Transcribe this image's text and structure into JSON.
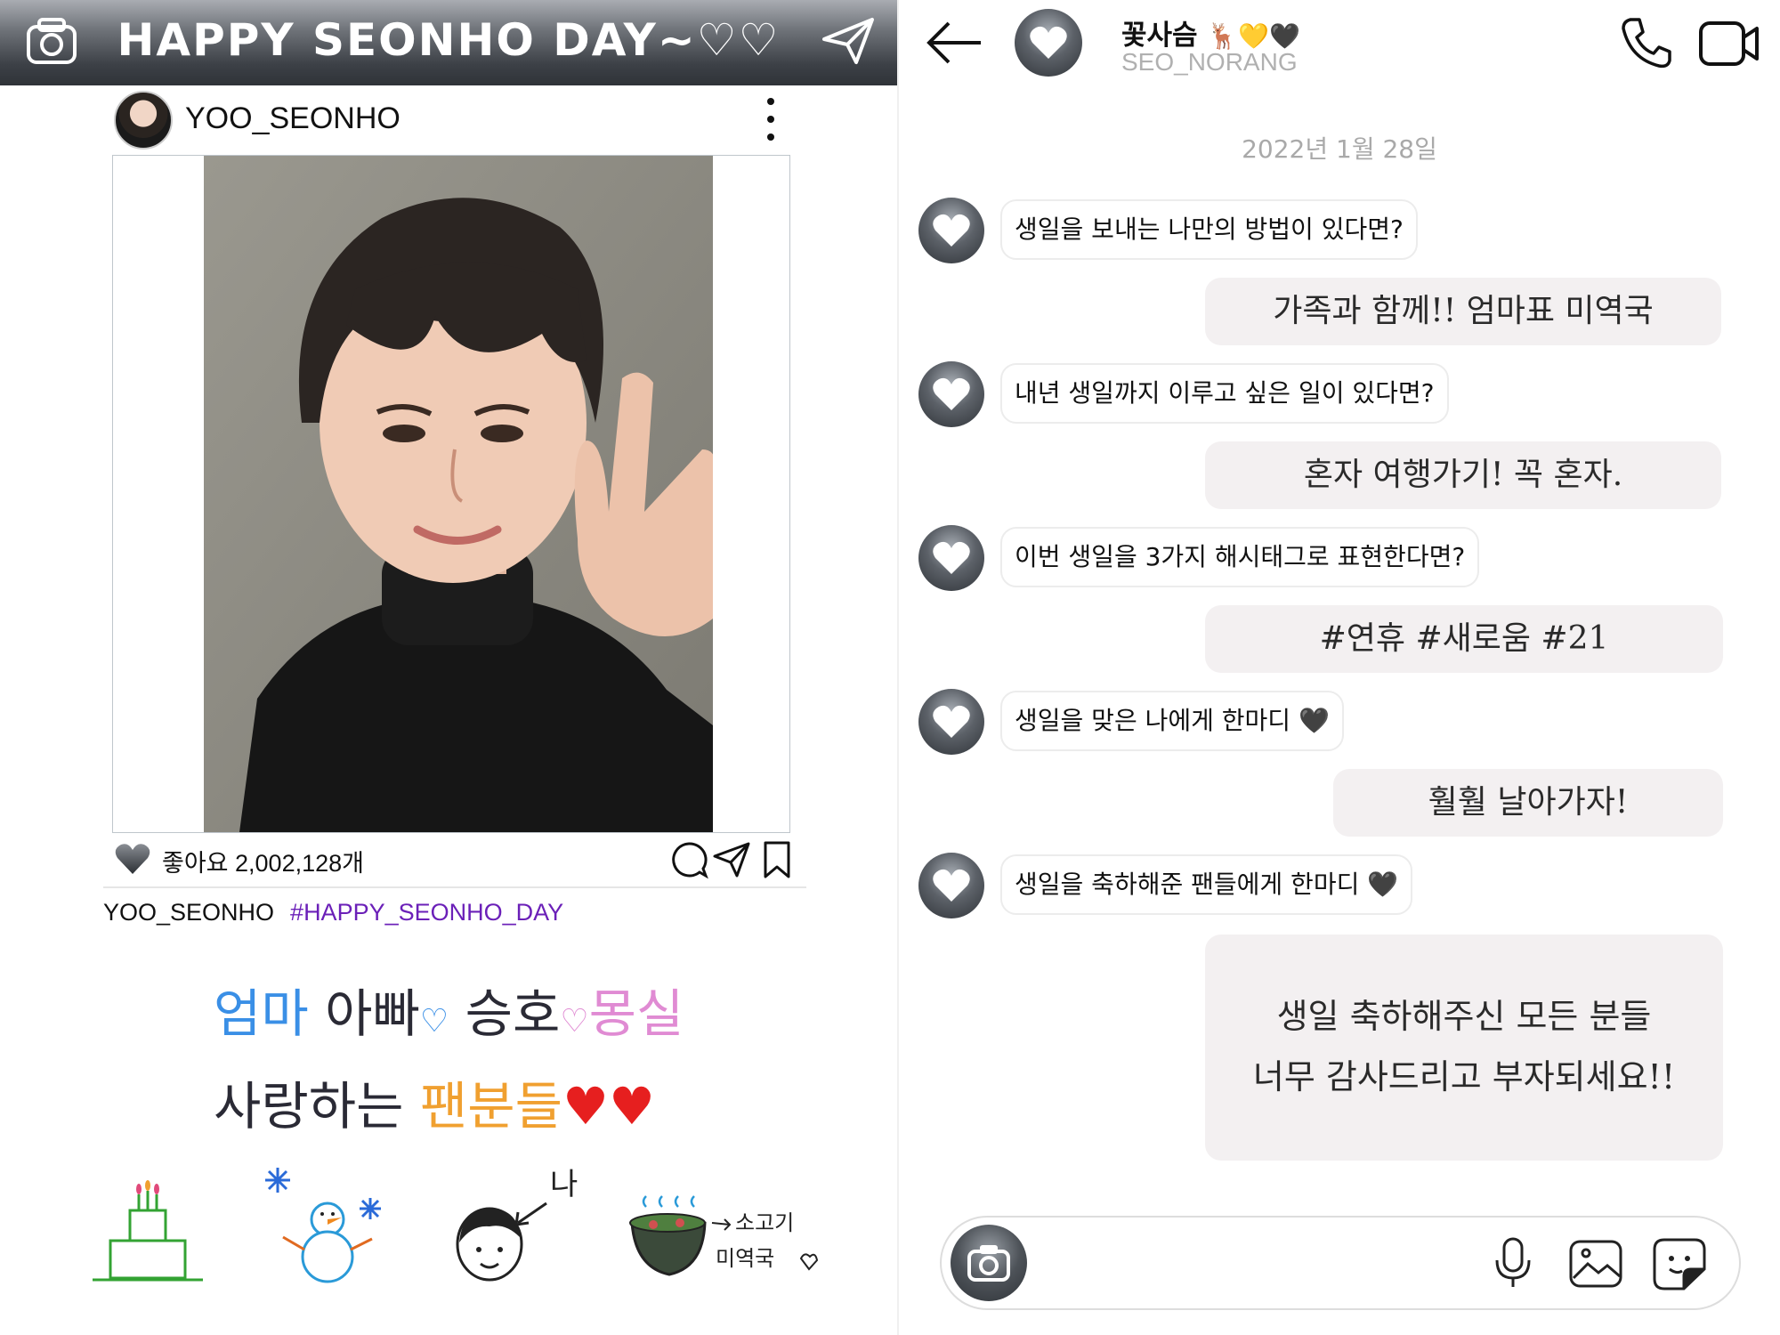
{
  "left": {
    "banner_title": "HAPPY SEONHO DAY~♡♡",
    "post": {
      "username": "YOO_SEONHO",
      "likes_text": "좋아요 2,002,128개",
      "caption_user": "YOO_SEONHO",
      "caption_tag": "#HAPPY_SEONHO_DAY"
    },
    "handwritten": {
      "line1": [
        "엄마",
        "아빠",
        "♡",
        "승호",
        "♡",
        "몽실"
      ],
      "line2": [
        "사랑하는",
        "팬분들",
        "♥♥"
      ]
    },
    "doodle_labels": {
      "me": "나",
      "soup1": "소고기",
      "soup2": "미역국"
    }
  },
  "right": {
    "chat_name": "꽃사슴",
    "chat_name_emoji": "🦌💛🖤",
    "chat_handle": "SEO_NORANG",
    "date": "2022년 1월 28일",
    "messages": [
      {
        "q": "생일을 보내는 나만의 방법이 있다면?",
        "a": "가족과 함께!! 엄마표 미역국"
      },
      {
        "q": "내년 생일까지 이루고 싶은 일이 있다면?",
        "a": "혼자 여행가기! 꼭 혼자."
      },
      {
        "q": "이번 생일을 3가지 해시태그로 표현한다면?",
        "a": "#연휴 #새로움 #21"
      },
      {
        "q": "생일을 맞은 나에게 한마디 🖤",
        "a": "훨훨 날아가자!"
      },
      {
        "q": "생일을 축하해준 팬들에게 한마디 🖤",
        "a1": "생일 축하해주신 모든 분들",
        "a2": "너무 감사드리고 부자되세요!!"
      }
    ]
  },
  "colors": {
    "banner": "#3d4147",
    "hashtag": "#6b20b8",
    "answer_bubble": "#f3f0f1",
    "date_text": "#a9a9a9"
  },
  "icons": [
    "camera-icon",
    "send-icon",
    "more-icon",
    "heart-icon",
    "comment-icon",
    "share-icon",
    "bookmark-icon",
    "back-arrow-icon",
    "phone-icon",
    "video-icon",
    "mic-icon",
    "gallery-icon",
    "sticker-icon"
  ]
}
